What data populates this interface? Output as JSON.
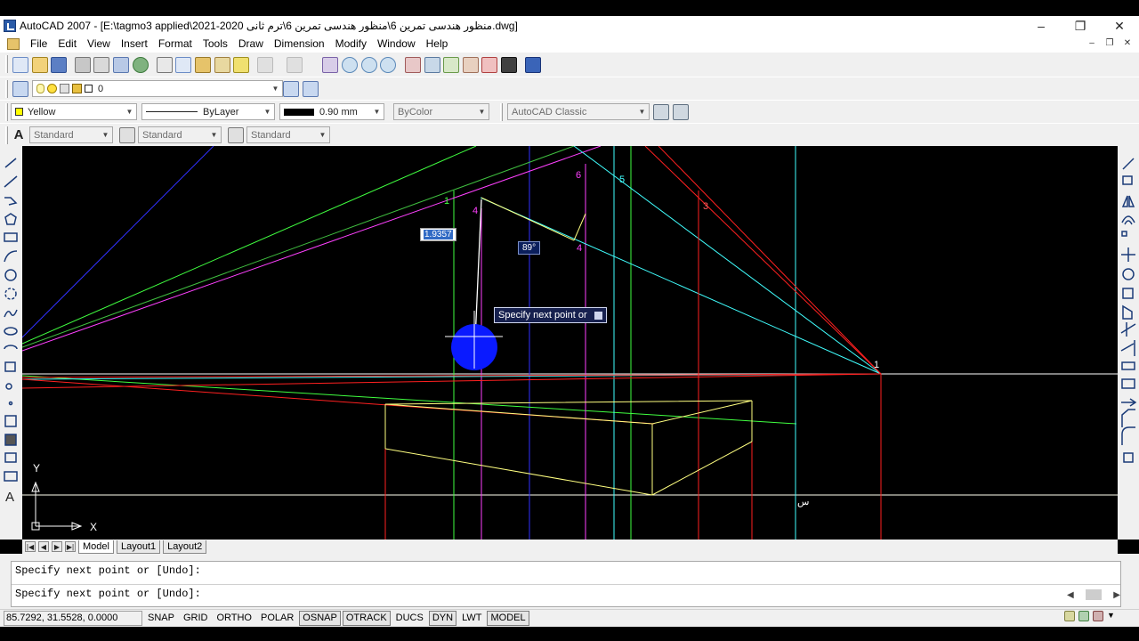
{
  "window": {
    "title": "AutoCAD 2007 - [E:\\tagmo3 applied\\منظور هندسى تمرين 6\\منظور هندسى تمرين 6\\ترم ثانى 2020-2021.dwg]",
    "controls": {
      "minimize": "–",
      "maximize": "❐",
      "close": "✕"
    },
    "mdi_controls": {
      "minimize": "–",
      "restore": "❐",
      "close": "✕"
    }
  },
  "menu": [
    "File",
    "Edit",
    "View",
    "Insert",
    "Format",
    "Tools",
    "Draw",
    "Dimension",
    "Modify",
    "Window",
    "Help"
  ],
  "layers_toolbar": {
    "current_layer": "0"
  },
  "properties_toolbar": {
    "color": "Yellow",
    "linetype": "ByLayer",
    "lineweight": "0.90 mm",
    "plotstyle": "ByColor",
    "workspace": "AutoCAD Classic"
  },
  "styles_toolbar": {
    "text_style": "Standard",
    "dim_style": "Standard",
    "table_style": "Standard"
  },
  "drawing": {
    "point_labels": [
      "1",
      "4",
      "6",
      "5",
      "3",
      "4",
      "1",
      "س"
    ],
    "dynamic_input_value": "1.9357",
    "dynamic_angle": "89°",
    "tooltip_prompt": "Specify next point or",
    "ucs_x_label": "X",
    "ucs_y_label": "Y",
    "colors": {
      "background": "#000000",
      "yellow_geometry": "#ffff80",
      "red": "#ff2020",
      "green": "#40ff40",
      "magenta": "#ff40ff",
      "cyan": "#40ffff",
      "blue": "#3030ff",
      "white": "#ffffff"
    }
  },
  "layout_tabs": {
    "model": "Model",
    "layout1": "Layout1",
    "layout2": "Layout2"
  },
  "command_history": [
    "Specify next point or [Undo]:",
    "Specify next point or [Undo]:"
  ],
  "status": {
    "coordinates": "85.7292, 31.5528, 0.0000",
    "toggles": [
      "SNAP",
      "GRID",
      "ORTHO",
      "POLAR",
      "OSNAP",
      "OTRACK",
      "DUCS",
      "DYN",
      "LWT",
      "MODEL"
    ],
    "active_toggles": [
      "OSNAP",
      "OTRACK",
      "DYN",
      "MODEL"
    ]
  }
}
